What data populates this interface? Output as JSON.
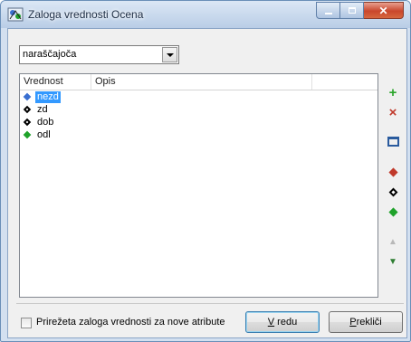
{
  "window": {
    "title": "Zaloga vrednosti Ocena",
    "icons": {
      "app": "app-icon",
      "minimize": "minimize-icon",
      "maximize": "maximize-icon",
      "close": "close-icon"
    }
  },
  "sort": {
    "selected": "naraščajoča",
    "dropdown_icon": "chevron-down-icon"
  },
  "list": {
    "columns": [
      "Vrednost",
      "Opis",
      ""
    ],
    "rows": [
      {
        "label": "nezd",
        "icon": "blue-diamond-icon",
        "color": "#3a6fd0",
        "selected": true
      },
      {
        "label": "zd",
        "icon": "black-diamond-icon",
        "color": "#000000",
        "selected": false
      },
      {
        "label": "dob",
        "icon": "black-diamond-icon",
        "color": "#000000",
        "selected": false
      },
      {
        "label": "odl",
        "icon": "green-diamond-icon",
        "color": "#1fa22a",
        "selected": false
      }
    ]
  },
  "toolbar": {
    "items": [
      {
        "name": "add-icon",
        "glyph": "+",
        "color": "#2aa52a"
      },
      {
        "name": "delete-icon",
        "glyph": "×",
        "color": "#c0392b"
      },
      {
        "name": "edit-icon",
        "glyph": "",
        "color": "#2a5b9e"
      },
      {
        "name": "red-diamond-icon",
        "glyph": "",
        "color": "#c0392b"
      },
      {
        "name": "black-diamond-icon",
        "glyph": "",
        "color": "#000000"
      },
      {
        "name": "green-diamond-icon",
        "glyph": "",
        "color": "#1fa22a"
      },
      {
        "name": "move-up-icon",
        "glyph": "▲",
        "color": "#b8b8b8"
      },
      {
        "name": "move-down-icon",
        "glyph": "▼",
        "color": "#2e7d32"
      }
    ]
  },
  "footer": {
    "checkbox_label": "Prirežeta zaloga vrednosti za nove atribute",
    "checkbox_checked": false,
    "ok_label": "V redu",
    "ok_mnemonic": "V",
    "ok_rest": " redu",
    "cancel_mnemonic": "P",
    "cancel_rest": "rekliči",
    "cancel_label": "Prekliči"
  }
}
